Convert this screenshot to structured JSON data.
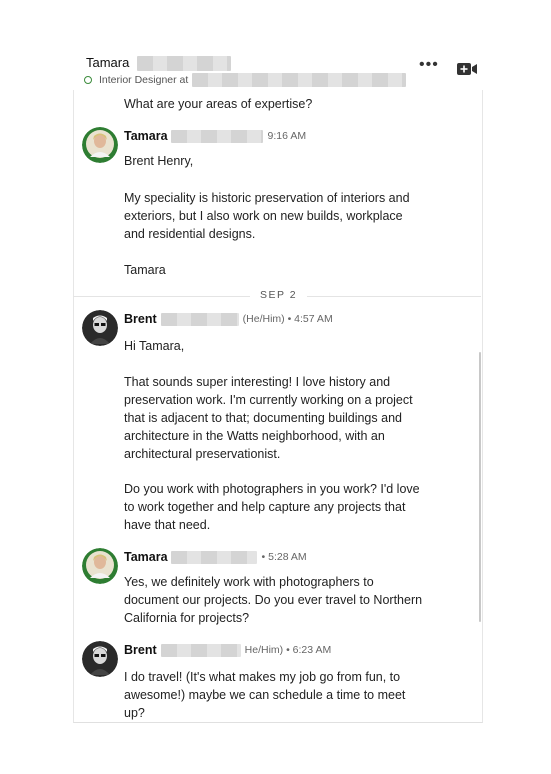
{
  "header": {
    "name": "Tamara",
    "subtitle": "Interior Designer at",
    "more_label": "•••"
  },
  "messages": {
    "prev_question": "What are your areas of expertise?",
    "m1": {
      "sender": "Tamara",
      "time": "9:16 AM",
      "p1": "Brent Henry,",
      "p2": "My speciality is historic preservation of interiors and exteriors, but I also work on new builds, workplace and residential designs.",
      "p3": "Tamara"
    },
    "date_divider": "SEP 2",
    "m2": {
      "sender": "Brent",
      "pronoun_time": "(He/Him) • 4:57 AM",
      "p1": "Hi Tamara,",
      "p2": "That sounds super interesting! I love history and preservation work. I'm currently working on a project that is adjacent to that; documenting buildings and architecture in the Watts neighborhood, with an architectural preservationist.",
      "p3": "Do you work with photographers in you work? I'd love to work together and help capture any projects that have that need."
    },
    "m3": {
      "sender": "Tamara",
      "time": "• 5:28 AM",
      "p1": "Yes, we definitely work with photographers to document our projects. Do you ever travel to Northern California for projects?"
    },
    "m4": {
      "sender": "Brent",
      "pronoun_time": "He/Him) • 6:23 AM",
      "p1": "I do travel! (It's what makes my job go from fun, to awesome!) maybe we can schedule a time to meet up?"
    }
  },
  "colors": {
    "status": "#3c8c3c",
    "badge": "#2e7d32"
  },
  "icons": {
    "more": "more-icon",
    "video": "video-call-icon"
  }
}
